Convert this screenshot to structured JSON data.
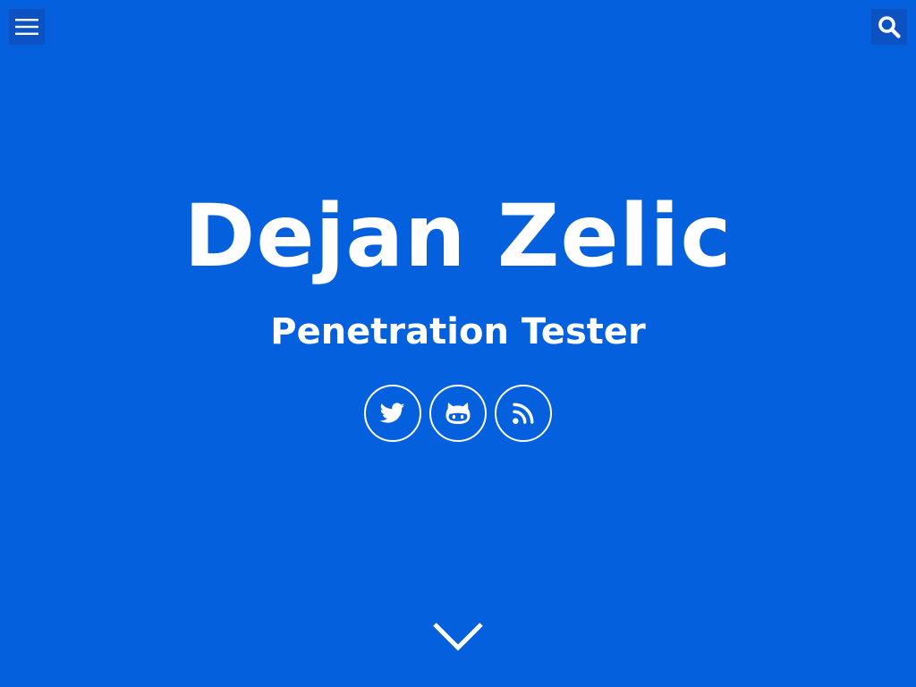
{
  "header": {
    "menu_icon": "hamburger-menu-icon",
    "search_icon": "search-icon"
  },
  "hero": {
    "title": "Dejan Zelic",
    "subtitle": "Penetration Tester"
  },
  "social": [
    {
      "icon": "twitter-icon"
    },
    {
      "icon": "github-icon"
    },
    {
      "icon": "rss-icon"
    }
  ],
  "scroll": {
    "icon": "chevron-down-icon"
  },
  "colors": {
    "background": "#0560dd",
    "button_background": "#0d52c2",
    "foreground": "#ffffff"
  }
}
